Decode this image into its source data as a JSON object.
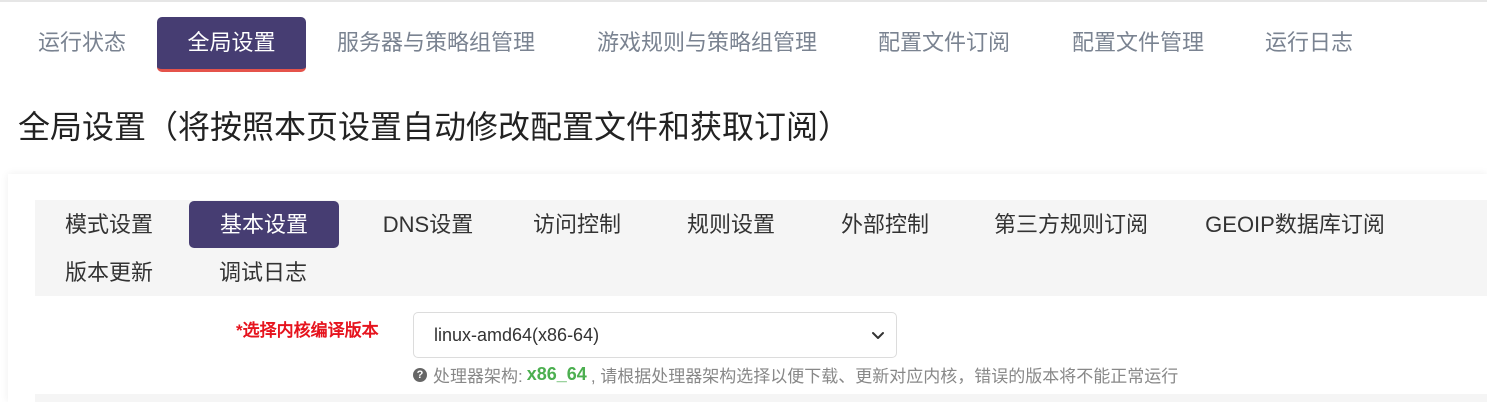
{
  "top_tabs": [
    {
      "label": "运行状态",
      "active": false
    },
    {
      "label": "全局设置",
      "active": true
    },
    {
      "label": "服务器与策略组管理",
      "active": false
    },
    {
      "label": "游戏规则与策略组管理",
      "active": false
    },
    {
      "label": "配置文件订阅",
      "active": false
    },
    {
      "label": "配置文件管理",
      "active": false
    },
    {
      "label": "运行日志",
      "active": false
    }
  ],
  "page_title": "全局设置（将按照本页设置自动修改配置文件和获取订阅）",
  "sub_tabs": [
    {
      "label": "模式设置",
      "active": false
    },
    {
      "label": "基本设置",
      "active": true
    },
    {
      "label": "DNS设置",
      "active": false
    },
    {
      "label": "访问控制",
      "active": false
    },
    {
      "label": "规则设置",
      "active": false
    },
    {
      "label": "外部控制",
      "active": false
    },
    {
      "label": "第三方规则订阅",
      "active": false
    },
    {
      "label": "GEOIP数据库订阅",
      "active": false
    },
    {
      "label": "版本更新",
      "active": false
    },
    {
      "label": "调试日志",
      "active": false
    }
  ],
  "core_version": {
    "label": "*选择内核编译版本",
    "selected": "linux-amd64(x86-64)",
    "help_prefix": "处理器架构:",
    "arch": "x86_64",
    "help_suffix": ", 请根据处理器架构选择以便下载、更新对应内核，错误的版本将不能正常运行",
    "help_icon": "question-circle-icon",
    "chevron_icon": "chevron-down-icon"
  },
  "colors": {
    "accent": "#463d72",
    "active_underline": "#e5534b",
    "required_label": "#e6141e",
    "arch_value": "#4caf50"
  }
}
